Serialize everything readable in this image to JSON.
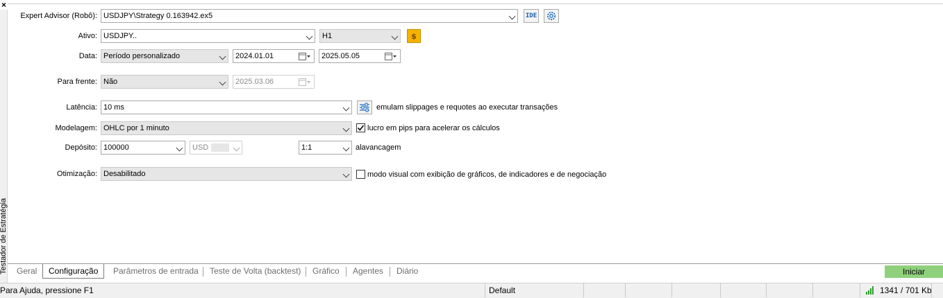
{
  "side_panel": {
    "title": "Testador de Estratégia",
    "close": "×"
  },
  "form": {
    "expert": {
      "label": "Expert Advisor (Robô):",
      "value": "USDJPY\\Strategy 0.163942.ex5",
      "ide_label": "IDE"
    },
    "symbol": {
      "label": "Ativo:",
      "value": "USDJPY..",
      "timeframe": "H1"
    },
    "date": {
      "label": "Data:",
      "mode": "Período personalizado",
      "from": "2024.01.01",
      "to": "2025.05.05"
    },
    "forward": {
      "label": "Para frente:",
      "value": "Não",
      "date": "2025.03.06"
    },
    "latency": {
      "label": "Latência:",
      "value": "10 ms",
      "note": "emulam slippages e requotes ao executar transações"
    },
    "modeling": {
      "label": "Modelagem:",
      "value": "OHLC por 1 minuto",
      "checkbox_label": "lucro em pips para acelerar os cálculos",
      "checked": true
    },
    "deposit": {
      "label": "Depósito:",
      "value": "100000",
      "currency": "USD",
      "leverage": "1:1",
      "leverage_label": "alavancagem"
    },
    "optimization": {
      "label": "Otimização:",
      "value": "Desabilitado",
      "checkbox_label": "modo visual com exibição de gráficos, de indicadores e de negociação",
      "checked": false
    }
  },
  "tabs": [
    "Geral",
    "Configuração",
    "Parâmetros de entrada",
    "Teste de Volta (backtest)",
    "Gráfico",
    "Agentes",
    "Diário"
  ],
  "active_tab": "Configuração",
  "start_button": "Iniciar",
  "status_bar": {
    "help": "Para Ajuda, pressione F1",
    "profile": "Default",
    "traffic": "1341 / 701 Kb"
  },
  "colors": {
    "start_button": "#8fd07c",
    "coin_icon": "#f5b300",
    "signal_icon": "#2e9e2e"
  }
}
